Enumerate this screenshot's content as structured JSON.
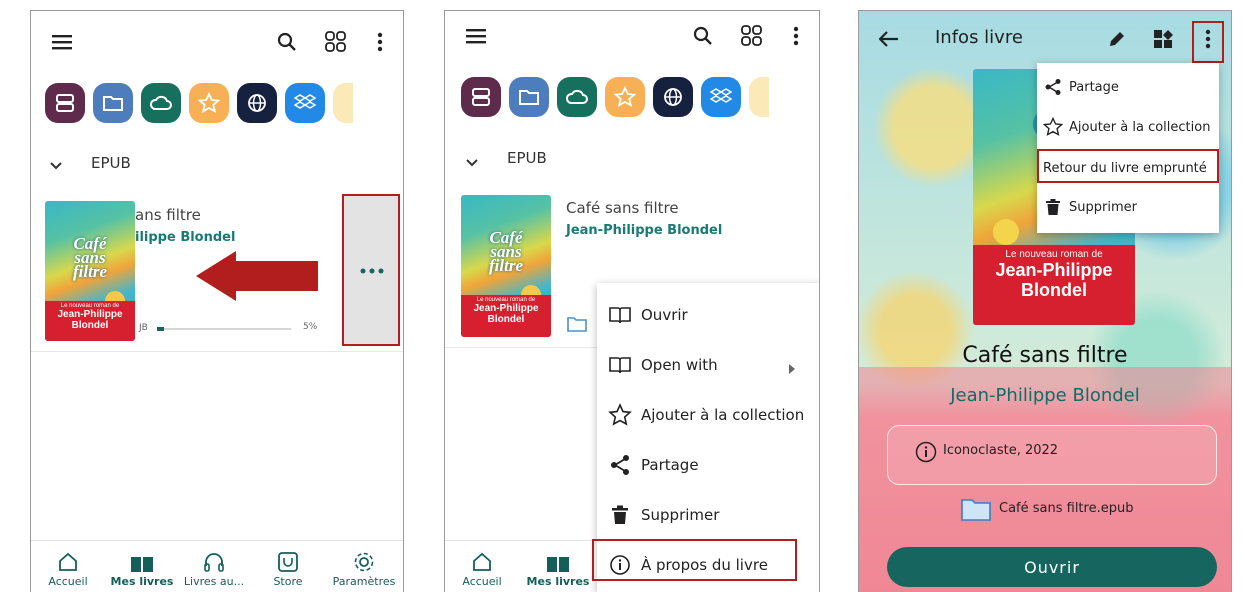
{
  "panel1": {
    "section": "EPUB",
    "book": {
      "title_partial": "ans filtre",
      "author_partial": "ilippe Blondel",
      "format_partial": "JB",
      "progress_label": "5%",
      "progress": 0.05
    }
  },
  "panel2": {
    "section": "EPUB",
    "book": {
      "title": "Café sans filtre",
      "author": "Jean-Philippe Blondel"
    },
    "menu": [
      "Ouvrir",
      "Open with",
      "Ajouter à la collection",
      "Partage",
      "Supprimer",
      "À propos du livre"
    ]
  },
  "panel3": {
    "header_title": "Infos livre",
    "menu": [
      "Partage",
      "Ajouter à la collection",
      "Retour du livre emprunté",
      "Supprimer"
    ],
    "title": "Café sans filtre",
    "author": "Jean-Philippe Blondel",
    "publisher": "Iconoclaste, 2022",
    "file": "Café sans filtre.epub",
    "open_button": "Ouvrir"
  },
  "cover": {
    "title_lines": [
      "Café",
      "sans",
      "filtre"
    ],
    "band_small": "Le nouveau roman de",
    "band_name": [
      "Jean-Philippe",
      "Blondel"
    ]
  },
  "nav": [
    "Accueil",
    "Mes livres",
    "Livres au...",
    "Store",
    "Paramètres"
  ],
  "colors": {
    "accent": "#16655f",
    "highlight": "#b21d1d",
    "menu_bg": "#ffffff"
  }
}
